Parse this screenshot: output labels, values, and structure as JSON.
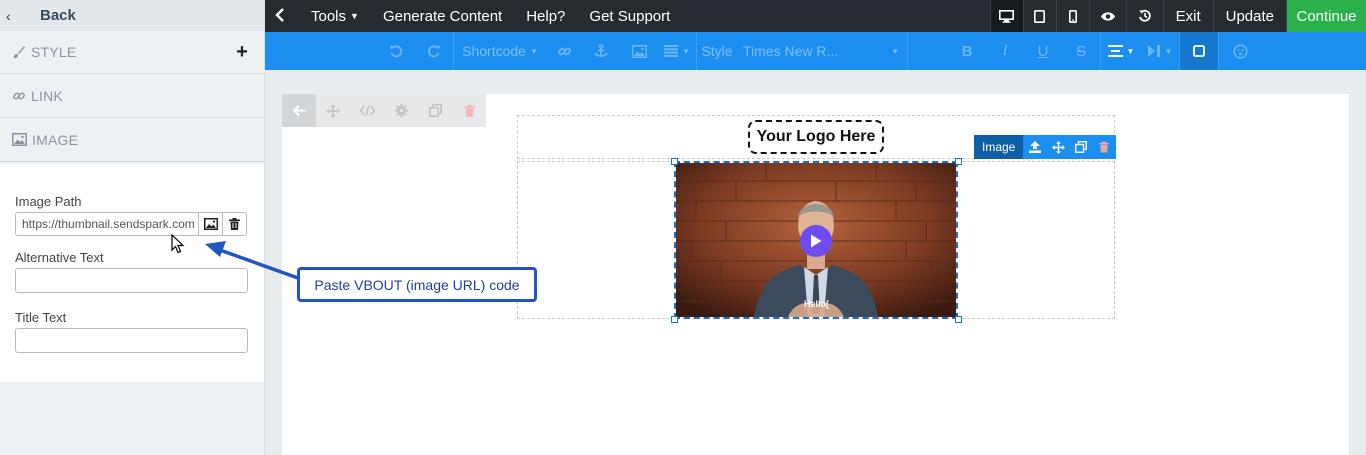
{
  "left_panel": {
    "back_label": "Back",
    "sections": [
      {
        "label": "STYLE",
        "icon": "brush-icon"
      },
      {
        "label": "LINK",
        "icon": "link-icon"
      },
      {
        "label": "IMAGE",
        "icon": "image-icon"
      }
    ],
    "style_add": "+",
    "form": {
      "image_path_label": "Image Path",
      "image_path_value": "https://thumbnail.sendspark.com",
      "alt_text_label": "Alternative Text",
      "alt_text_value": "",
      "title_text_label": "Title Text",
      "title_text_value": ""
    }
  },
  "topbar": {
    "menus": [
      "Tools",
      "Generate Content",
      "Help?",
      "Get Support"
    ],
    "exit_label": "Exit",
    "update_label": "Update",
    "continue_label": "Continue",
    "device_icons": [
      "desktop-icon",
      "tablet-icon",
      "mobile-icon"
    ],
    "action_icons": [
      "preview-eye-icon",
      "history-icon"
    ]
  },
  "toolbar": {
    "shortcode_label": "Shortcode",
    "style_label": "Style",
    "font_label": "Times New R..."
  },
  "canvas": {
    "logo_text": "Your Logo Here",
    "image_tools_label": "Image",
    "video_caption": "Hello["
  },
  "callout": {
    "text": "Paste VBOUT (image URL) code"
  },
  "colors": {
    "toolbar_blue": "#1c8ef0",
    "topbar_dark": "#262b31",
    "continue_green": "#2ab14b",
    "callout_blue": "#1f56c4"
  }
}
